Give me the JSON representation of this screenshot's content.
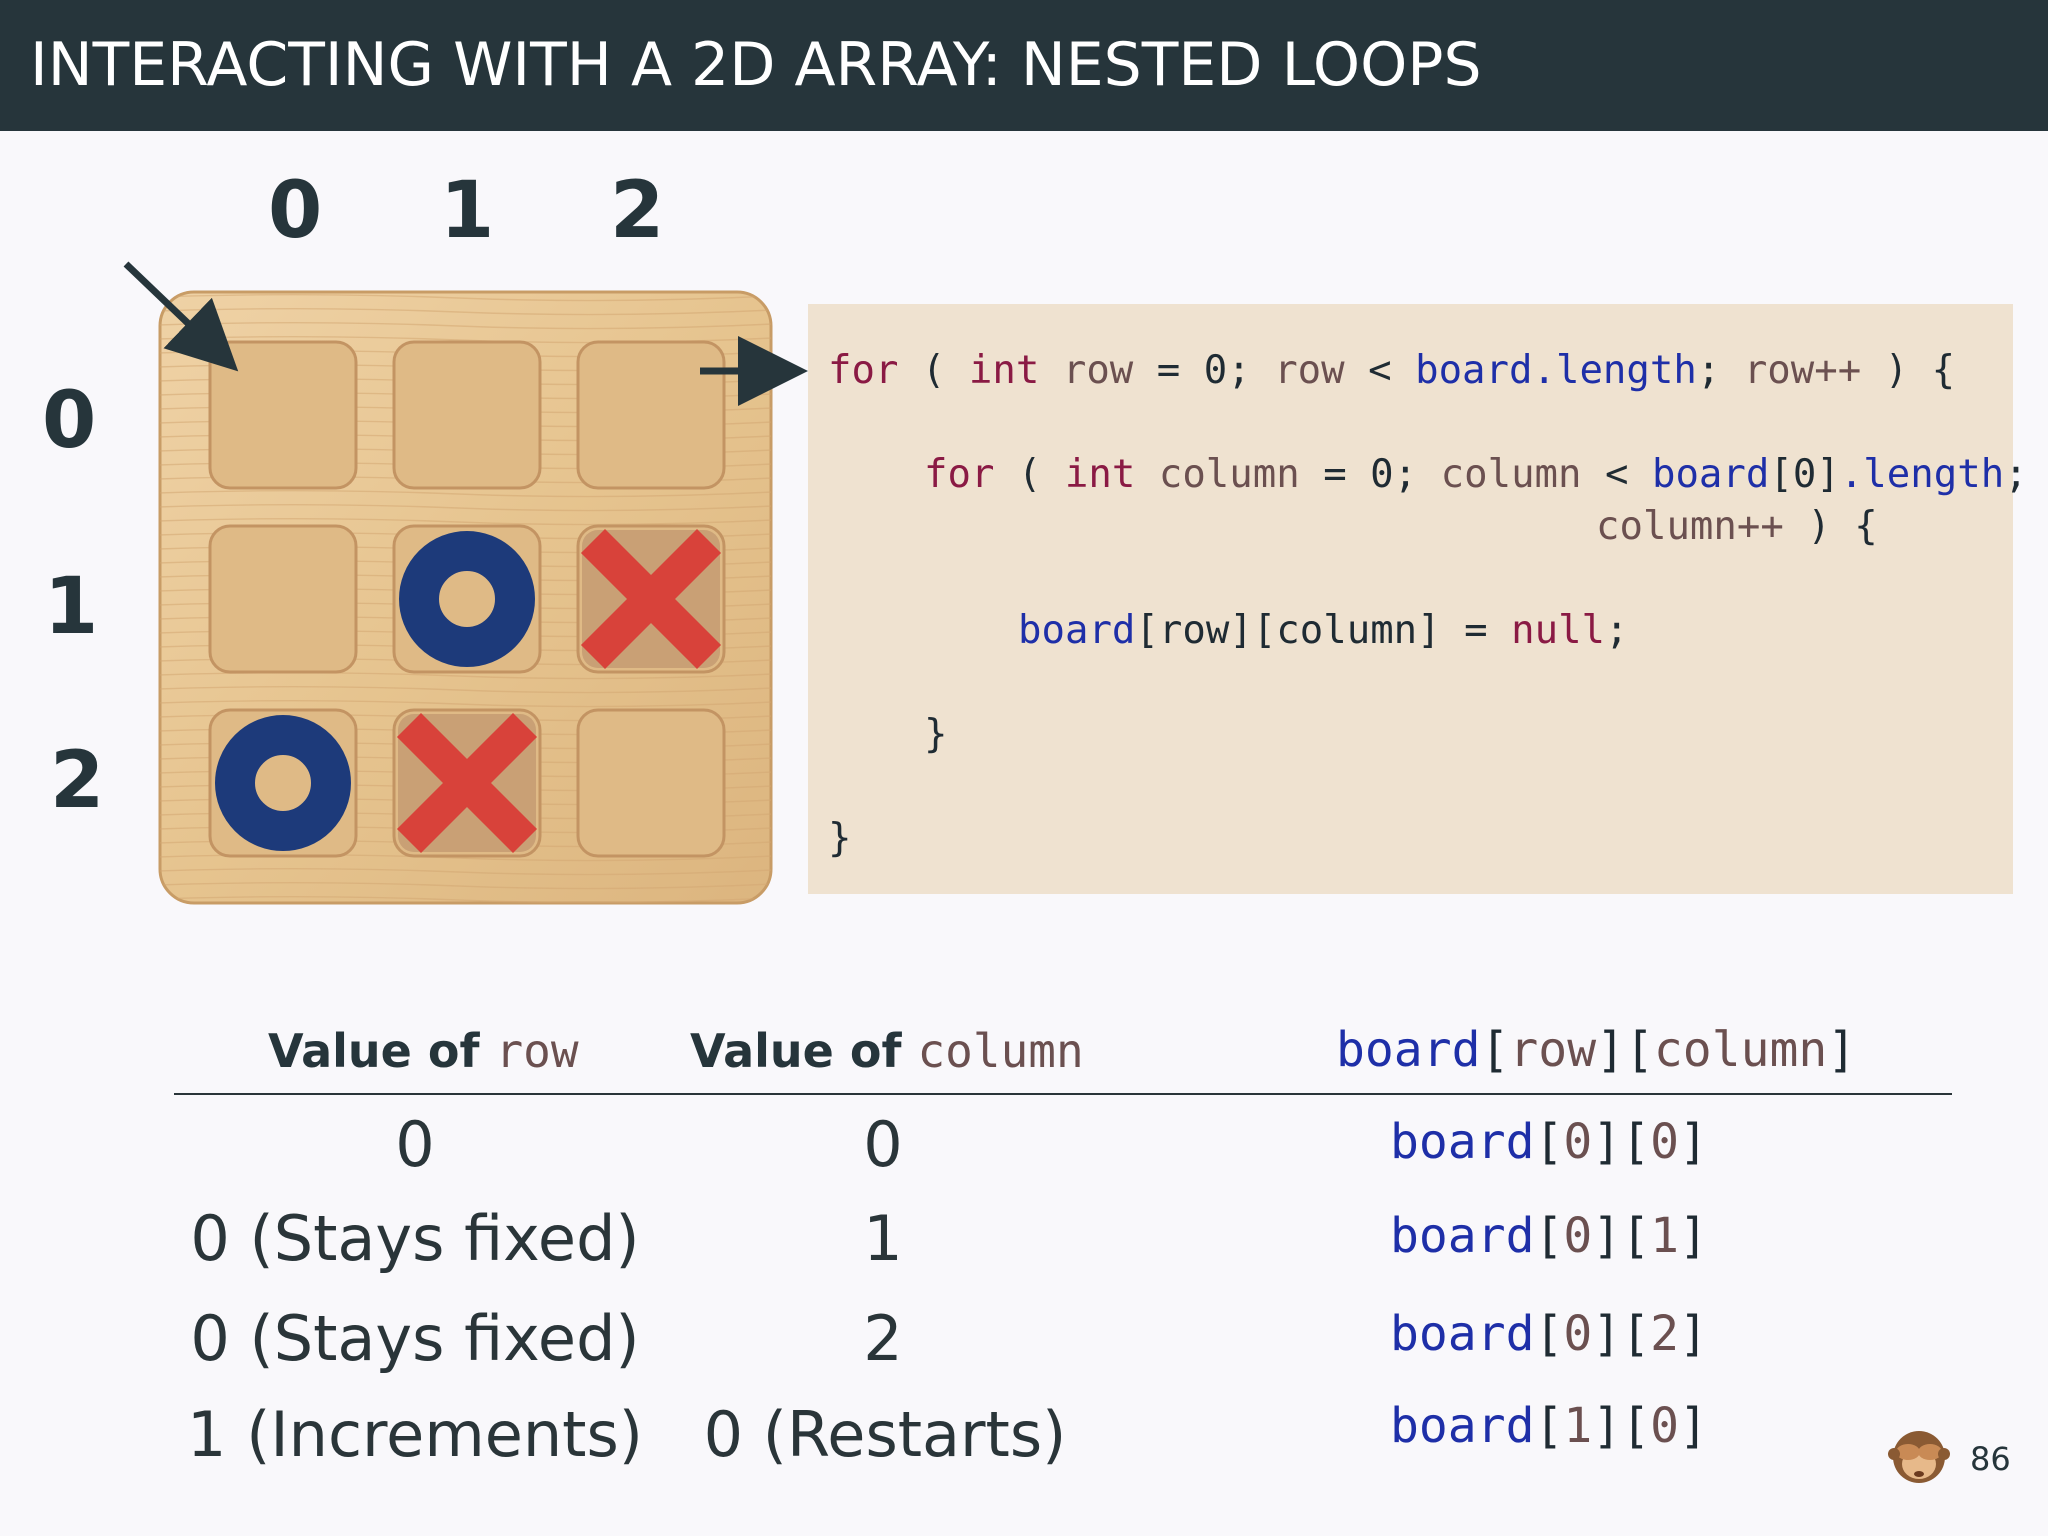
{
  "slide": {
    "title": "INTERACTING WITH A 2D ARRAY: NESTED LOOPS",
    "page_number": "86"
  },
  "board": {
    "col_indices": [
      "0",
      "1",
      "2"
    ],
    "row_indices": [
      "0",
      "1",
      "2"
    ],
    "cells": [
      [
        "",
        "",
        ""
      ],
      [
        "",
        "O",
        "X"
      ],
      [
        "O",
        "X",
        ""
      ]
    ],
    "colors": {
      "wood": "#e8c99a",
      "o_piece": "#1d3a7a",
      "x_piece": "#d8423a"
    }
  },
  "code": {
    "lines": [
      {
        "kw1": "for",
        "p1": " ( ",
        "kw2": "int",
        "sp": " ",
        "v1": "row",
        "o1": " = 0; ",
        "v2": "row",
        "o2": " < ",
        "f1": "board.length",
        "o3": "; ",
        "v3": "row++",
        "o4": " ) {"
      },
      {
        "kw1": "for",
        "p1": " ( ",
        "kw2": "int",
        "sp": " ",
        "v1": "column",
        "o1": " = 0; ",
        "v2": "column",
        "o2": " < ",
        "f1": "board",
        "o3": "[0]",
        "f2": ".length",
        "o4": ";"
      },
      {
        "v1": "column++",
        "o1": " ) {"
      },
      {
        "f1": "board",
        "o1": "[row][column]",
        "o2": " = ",
        "kw1": "null",
        "o3": ";"
      },
      {
        "o1": "}"
      },
      {
        "o1": "}"
      }
    ]
  },
  "table": {
    "headers": {
      "col1_prefix": "Value of ",
      "col1_var": "row",
      "col2_prefix": "Value of ",
      "col2_var": "column",
      "col3_board": "board",
      "col3_open1": "[",
      "col3_row": "row",
      "col3_close1": "][",
      "col3_col": "column",
      "col3_close2": "]"
    },
    "rows": [
      {
        "row": "0",
        "column": "0",
        "b": "board",
        "o1": "[",
        "i": "0",
        "m": "][",
        "j": "0",
        "c": "]"
      },
      {
        "row": "0 (Stays fixed)",
        "column": "1",
        "b": "board",
        "o1": "[",
        "i": "0",
        "m": "][",
        "j": "1",
        "c": "]"
      },
      {
        "row": "0 (Stays fixed)",
        "column": "2",
        "b": "board",
        "o1": "[",
        "i": "0",
        "m": "][",
        "j": "2",
        "c": "]"
      },
      {
        "row": "1 (Increments)",
        "column": "0 (Restarts)",
        "b": "board",
        "o1": "[",
        "i": "1",
        "m": "][",
        "j": "0",
        "c": "]"
      }
    ]
  },
  "icons": {
    "corner": "see-no-evil-monkey-icon"
  }
}
